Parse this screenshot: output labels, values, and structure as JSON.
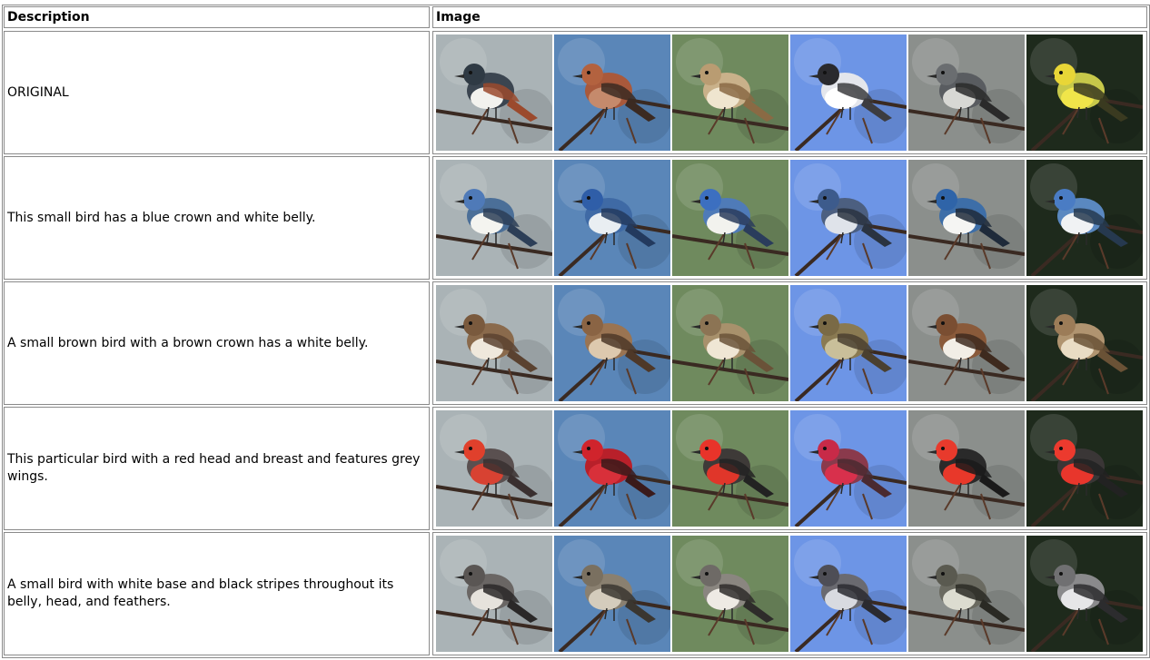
{
  "header": {
    "description_label": "Description",
    "image_label": "Image"
  },
  "backgrounds": [
    "#aab3b6",
    "#5a86b8",
    "#6f8a5e",
    "#6d95e6",
    "#8b8f8c",
    "#1e2a1c"
  ],
  "rows": [
    {
      "description": "ORIGINAL",
      "birds": [
        {
          "name": "kingfisher",
          "body": "#3b4550",
          "belly": "#f2f2ee",
          "accent": "#9b4a2d",
          "head": "#2f3a44"
        },
        {
          "name": "waxwing",
          "body": "#a9593b",
          "belly": "#c58a6c",
          "accent": "#3b2a22",
          "head": "#b3623f"
        },
        {
          "name": "sparrow",
          "body": "#c9b18a",
          "belly": "#efe5cf",
          "accent": "#8a6a44",
          "head": "#b99c72"
        },
        {
          "name": "tern",
          "body": "#e4e6ec",
          "belly": "#ffffff",
          "accent": "#3c3c40",
          "head": "#2a2a2e"
        },
        {
          "name": "mockingbird",
          "body": "#595c60",
          "belly": "#d8d8d4",
          "accent": "#2a2a2a",
          "head": "#6a6d70"
        },
        {
          "name": "warbler",
          "body": "#c7c84a",
          "belly": "#f0e54a",
          "accent": "#3a3a20",
          "head": "#e8d637"
        }
      ]
    },
    {
      "description": "This small bird has a blue crown and white belly.",
      "birds": [
        {
          "name": "blue-kingfisher",
          "body": "#4b6f98",
          "belly": "#f4f4f0",
          "accent": "#2c3e57",
          "head": "#4f7ab8"
        },
        {
          "name": "blue-waxwing",
          "body": "#3f6aa5",
          "belly": "#e9eef2",
          "accent": "#233a5e",
          "head": "#2f5ea8"
        },
        {
          "name": "blue-sparrow",
          "body": "#4f7bb8",
          "belly": "#f2f2ee",
          "accent": "#2a3c5c",
          "head": "#3c6fc0"
        },
        {
          "name": "blue-tern",
          "body": "#4c5f80",
          "belly": "#dfe3ea",
          "accent": "#2a3340",
          "head": "#3d5b8c"
        },
        {
          "name": "blue-mockingbird",
          "body": "#3d6ea8",
          "belly": "#f5f5f3",
          "accent": "#1e2a3a",
          "head": "#2f64a8"
        },
        {
          "name": "blue-warbler",
          "body": "#5a88c0",
          "belly": "#f0f2f4",
          "accent": "#26394f",
          "head": "#4a7cc4"
        }
      ]
    },
    {
      "description": "A small brown bird with a brown crown has a white belly.",
      "birds": [
        {
          "name": "brown-kingfisher",
          "body": "#8a6a4c",
          "belly": "#efe8dc",
          "accent": "#5a4230",
          "head": "#7a5a3e"
        },
        {
          "name": "brown-waxwing",
          "body": "#9a7452",
          "belly": "#ddc9ae",
          "accent": "#4e3828",
          "head": "#8a6444"
        },
        {
          "name": "brown-sparrow",
          "body": "#a8916c",
          "belly": "#efe6d4",
          "accent": "#6a5238",
          "head": "#8c7454"
        },
        {
          "name": "brown-tern",
          "body": "#8a7a52",
          "belly": "#c9bf9a",
          "accent": "#4a4030",
          "head": "#7a6a46"
        },
        {
          "name": "brown-mockingbird",
          "body": "#8a5a3a",
          "belly": "#f2eee6",
          "accent": "#3e2a1e",
          "head": "#7a4e32"
        },
        {
          "name": "brown-warbler",
          "body": "#b09470",
          "belly": "#e9dcc4",
          "accent": "#6a5236",
          "head": "#9c7c58"
        }
      ]
    },
    {
      "description": "This particular bird with a red head and breast and features grey wings.",
      "birds": [
        {
          "name": "red-kingfisher",
          "body": "#5a5050",
          "belly": "#d84232",
          "accent": "#3a3030",
          "head": "#e0402c"
        },
        {
          "name": "red-waxwing",
          "body": "#b8202a",
          "belly": "#d8303a",
          "accent": "#3a1a1a",
          "head": "#d0242c"
        },
        {
          "name": "red-sparrow",
          "body": "#3e3a38",
          "belly": "#e0362a",
          "accent": "#222",
          "head": "#e8342a"
        },
        {
          "name": "red-tern",
          "body": "#8a3a4c",
          "belly": "#d8304c",
          "accent": "#4a2a30",
          "head": "#c82a48"
        },
        {
          "name": "red-mockingbird",
          "body": "#2a2a2a",
          "belly": "#e8382a",
          "accent": "#1a1a1a",
          "head": "#e83a2c"
        },
        {
          "name": "red-warbler",
          "body": "#3a3636",
          "belly": "#e8362c",
          "accent": "#222",
          "head": "#ec3a2e"
        }
      ]
    },
    {
      "description": "A small bird with white base and black stripes throughout its belly, head, and feathers.",
      "birds": [
        {
          "name": "striped-kingfisher",
          "body": "#6a6664",
          "belly": "#e6e2dc",
          "accent": "#2a2828",
          "head": "#5a5654"
        },
        {
          "name": "striped-waxwing",
          "body": "#8a8070",
          "belly": "#d4ccbc",
          "accent": "#3a3630",
          "head": "#7a7060"
        },
        {
          "name": "striped-sparrow",
          "body": "#8a8680",
          "belly": "#eeeae4",
          "accent": "#2e2c2a",
          "head": "#6e6a66"
        },
        {
          "name": "striped-tern",
          "body": "#6a6a70",
          "belly": "#d8dae0",
          "accent": "#2a2a30",
          "head": "#4e4e56"
        },
        {
          "name": "striped-mockingbird",
          "body": "#6a6a60",
          "belly": "#dcdcd0",
          "accent": "#2a2a24",
          "head": "#5a5a50"
        },
        {
          "name": "striped-warbler",
          "body": "#8a8a8c",
          "belly": "#e6e6e8",
          "accent": "#2c2c2e",
          "head": "#707072"
        }
      ]
    }
  ]
}
